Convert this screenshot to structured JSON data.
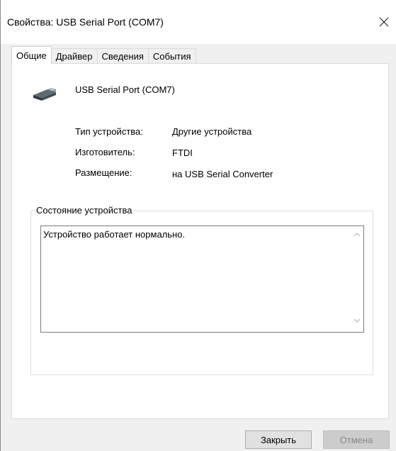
{
  "window": {
    "title": "Свойства: USB Serial Port (COM7)"
  },
  "tabs": [
    {
      "label": "Общие",
      "active": true
    },
    {
      "label": "Драйвер",
      "active": false
    },
    {
      "label": "Сведения",
      "active": false
    },
    {
      "label": "События",
      "active": false
    }
  ],
  "device": {
    "name": "USB Serial Port (COM7)",
    "icon": "serial-port-icon"
  },
  "properties": [
    {
      "label": "Тип устройства:",
      "value": "Другие устройства"
    },
    {
      "label": "Изготовитель:",
      "value": "FTDI"
    },
    {
      "label": "Размещение:",
      "value": "на USB Serial Converter"
    }
  ],
  "status": {
    "group_title": "Состояние устройства",
    "text": "Устройство работает нормально."
  },
  "buttons": {
    "close": "Закрыть",
    "cancel": "Отмена"
  },
  "colors": {
    "dialog_bg": "#f0f0f0",
    "panel_bg": "#ffffff",
    "disabled_text": "#8a8a8a"
  }
}
